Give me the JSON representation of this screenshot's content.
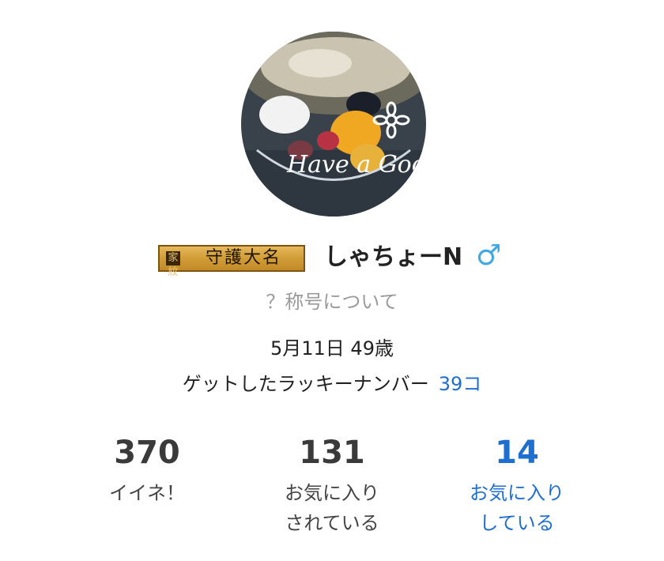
{
  "profile": {
    "avatar_text": "Have a Good Day",
    "title_badge": "守護大名",
    "title_badge_icon": "家紋",
    "username": "しゃちょーN",
    "gender_icon": "♂",
    "title_help": "？称号について",
    "birthday_age": "5月11日 49歳",
    "lucky_label": "ゲットしたラッキーナンバー",
    "lucky_count": "39コ"
  },
  "stats": [
    {
      "value": "370",
      "label_line1": "イイネ！",
      "label_line2": ""
    },
    {
      "value": "131",
      "label_line1": "お気に入り",
      "label_line2": "されている"
    },
    {
      "value": "14",
      "label_line1": "お気に入り",
      "label_line2": "している"
    }
  ],
  "colors": {
    "accent_blue": "#1f6fd0",
    "gender_blue": "#3fa9e5",
    "muted_gray": "#9a9a9a",
    "badge_gold": "#d29f3b"
  }
}
